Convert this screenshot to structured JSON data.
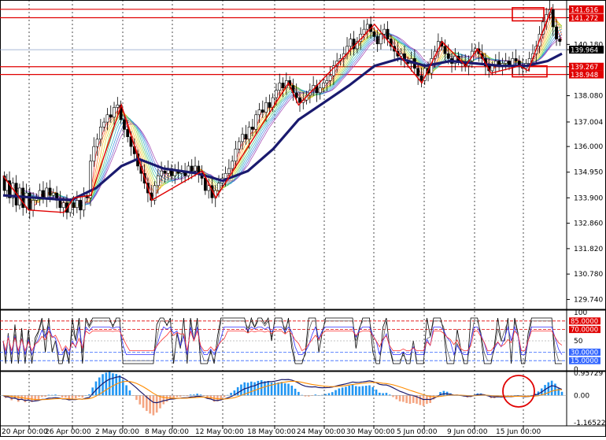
{
  "colors": {
    "background": "#ffffff",
    "grid": "#000000",
    "candle": "#000000",
    "zigzag": "#e00000",
    "ma_slow": "#1a1a6e",
    "level": "#e00000",
    "current_price_line": "#8aa0c8",
    "rsi_black": "#000000",
    "rsi_blue": "#3333ff",
    "rsi_red": "#ff3333",
    "macd_pos": "#2196f3",
    "macd_neg": "#f4a582",
    "macd_line": "#1a1a6e",
    "signal_line": "#ff8c00"
  },
  "chart_data": [
    {
      "type": "candlestick",
      "panel": "price",
      "x_labels": [
        "20 Apr 00:00",
        "26 Apr 00:00",
        "2 May 00:00",
        "8 May 00:00",
        "12 May 00:00",
        "18 May 00:00",
        "24 May 00:00",
        "30 May 00:00",
        "5 Jun 00:00",
        "9 Jun 00:00",
        "15 Jun 00:00"
      ],
      "y_ticks": [
        "141.616",
        "141.272",
        "140.180",
        "139.964",
        "139.267",
        "138.948",
        "138.080",
        "137.004",
        "136.000",
        "134.950",
        "133.900",
        "132.860",
        "131.820",
        "130.780",
        "129.740"
      ],
      "ylim": [
        129.4,
        141.9
      ],
      "current_price": 139.964,
      "levels": [
        141.616,
        141.272,
        139.267,
        138.948
      ],
      "ohlc_path": [
        [
          0,
          134.8
        ],
        [
          3,
          134.2
        ],
        [
          6,
          134.6
        ],
        [
          10,
          133.9
        ],
        [
          14,
          134.5
        ],
        [
          18,
          133.6
        ],
        [
          22,
          134.3
        ],
        [
          26,
          133.5
        ],
        [
          30,
          134.1
        ],
        [
          34,
          133.4
        ],
        [
          38,
          133.8
        ],
        [
          42,
          133.9
        ],
        [
          46,
          134.2
        ],
        [
          50,
          133.9
        ],
        [
          54,
          134.3
        ],
        [
          58,
          134.0
        ],
        [
          62,
          134.1
        ],
        [
          66,
          133.8
        ],
        [
          70,
          133.5
        ],
        [
          74,
          133.7
        ],
        [
          78,
          133.3
        ],
        [
          82,
          133.7
        ],
        [
          86,
          133.5
        ],
        [
          90,
          133.8
        ],
        [
          94,
          133.4
        ],
        [
          98,
          134.0
        ],
        [
          102,
          133.9
        ],
        [
          106,
          135.4
        ],
        [
          110,
          136.0
        ],
        [
          114,
          136.3
        ],
        [
          118,
          136.8
        ],
        [
          122,
          137.0
        ],
        [
          126,
          137.3
        ],
        [
          130,
          137.2
        ],
        [
          134,
          137.6
        ],
        [
          138,
          137.7
        ],
        [
          142,
          137.1
        ],
        [
          146,
          136.7
        ],
        [
          150,
          136.4
        ],
        [
          154,
          136.0
        ],
        [
          158,
          135.7
        ],
        [
          162,
          135.2
        ],
        [
          166,
          134.9
        ],
        [
          170,
          134.5
        ],
        [
          174,
          134.1
        ],
        [
          178,
          133.8
        ],
        [
          182,
          134.4
        ],
        [
          186,
          134.8
        ],
        [
          190,
          135.0
        ],
        [
          194,
          134.9
        ],
        [
          198,
          135.1
        ],
        [
          202,
          134.8
        ],
        [
          206,
          135.0
        ],
        [
          210,
          134.9
        ],
        [
          214,
          135.0
        ],
        [
          218,
          134.8
        ],
        [
          222,
          135.2
        ],
        [
          226,
          135.0
        ],
        [
          230,
          135.2
        ],
        [
          234,
          134.9
        ],
        [
          238,
          134.7
        ],
        [
          242,
          134.2
        ],
        [
          246,
          134.4
        ],
        [
          250,
          133.9
        ],
        [
          254,
          134.2
        ],
        [
          258,
          134.5
        ],
        [
          262,
          134.7
        ],
        [
          266,
          134.9
        ],
        [
          270,
          135.1
        ],
        [
          274,
          135.4
        ],
        [
          278,
          135.9
        ],
        [
          282,
          136.2
        ],
        [
          286,
          136.5
        ],
        [
          290,
          136.3
        ],
        [
          294,
          136.8
        ],
        [
          298,
          136.7
        ],
        [
          302,
          137.3
        ],
        [
          306,
          137.5
        ],
        [
          310,
          137.4
        ],
        [
          314,
          137.8
        ],
        [
          318,
          137.6
        ],
        [
          322,
          138.0
        ],
        [
          326,
          138.3
        ],
        [
          330,
          138.6
        ],
        [
          334,
          138.4
        ],
        [
          338,
          138.7
        ],
        [
          342,
          138.5
        ],
        [
          346,
          138.2
        ],
        [
          350,
          138.0
        ],
        [
          354,
          137.8
        ],
        [
          358,
          137.9
        ],
        [
          362,
          138.1
        ],
        [
          366,
          138.3
        ],
        [
          370,
          138.5
        ],
        [
          374,
          138.2
        ],
        [
          378,
          138.4
        ],
        [
          382,
          138.6
        ],
        [
          386,
          138.7
        ],
        [
          390,
          138.9
        ],
        [
          394,
          139.3
        ],
        [
          398,
          139.5
        ],
        [
          402,
          139.6
        ],
        [
          406,
          139.8
        ],
        [
          410,
          140.1
        ],
        [
          414,
          140.4
        ],
        [
          418,
          140.0
        ],
        [
          422,
          140.3
        ],
        [
          426,
          140.6
        ],
        [
          430,
          140.8
        ],
        [
          434,
          141.0
        ],
        [
          438,
          140.7
        ],
        [
          442,
          140.5
        ],
        [
          446,
          140.2
        ],
        [
          450,
          140.6
        ],
        [
          454,
          140.8
        ],
        [
          458,
          140.4
        ],
        [
          462,
          140.1
        ],
        [
          466,
          139.9
        ],
        [
          470,
          139.7
        ],
        [
          474,
          139.8
        ],
        [
          478,
          139.5
        ],
        [
          482,
          139.4
        ],
        [
          486,
          139.6
        ],
        [
          490,
          139.2
        ],
        [
          494,
          138.9
        ],
        [
          498,
          138.7
        ],
        [
          502,
          139.2
        ],
        [
          506,
          139.0
        ],
        [
          510,
          139.6
        ],
        [
          514,
          139.9
        ],
        [
          518,
          140.3
        ],
        [
          522,
          140.1
        ],
        [
          526,
          139.8
        ],
        [
          530,
          139.6
        ],
        [
          534,
          139.4
        ],
        [
          538,
          139.7
        ],
        [
          542,
          139.5
        ],
        [
          546,
          139.4
        ],
        [
          550,
          139.3
        ],
        [
          554,
          139.5
        ],
        [
          558,
          139.9
        ],
        [
          562,
          140.0
        ],
        [
          566,
          139.8
        ],
        [
          570,
          139.6
        ],
        [
          574,
          139.3
        ],
        [
          578,
          139.1
        ],
        [
          582,
          139.3
        ],
        [
          586,
          139.5
        ],
        [
          590,
          139.3
        ],
        [
          594,
          139.4
        ],
        [
          598,
          139.5
        ],
        [
          602,
          139.3
        ],
        [
          606,
          139.6
        ],
        [
          610,
          139.5
        ],
        [
          614,
          139.3
        ],
        [
          618,
          139.2
        ],
        [
          622,
          139.4
        ],
        [
          626,
          139.6
        ],
        [
          630,
          139.8
        ],
        [
          634,
          140.1
        ],
        [
          638,
          140.6
        ],
        [
          642,
          141.1
        ],
        [
          646,
          141.4
        ],
        [
          650,
          141.6
        ],
        [
          654,
          140.9
        ],
        [
          658,
          140.4
        ],
        [
          662,
          140.3
        ]
      ],
      "zigzag": [
        [
          0,
          134.8
        ],
        [
          30,
          133.4
        ],
        [
          72,
          133.3
        ],
        [
          84,
          133.9
        ],
        [
          104,
          134.0
        ],
        [
          140,
          137.7
        ],
        [
          176,
          133.8
        ],
        [
          236,
          135.0
        ],
        [
          252,
          133.9
        ],
        [
          338,
          138.6
        ],
        [
          350,
          137.7
        ],
        [
          440,
          141.0
        ],
        [
          496,
          138.6
        ],
        [
          520,
          140.3
        ],
        [
          548,
          139.3
        ],
        [
          562,
          140.0
        ],
        [
          578,
          139.0
        ],
        [
          612,
          139.3
        ],
        [
          622,
          139.1
        ],
        [
          650,
          141.7
        ]
      ],
      "ma_slow": [
        [
          0,
          134.0
        ],
        [
          40,
          133.9
        ],
        [
          80,
          133.8
        ],
        [
          110,
          134.3
        ],
        [
          140,
          135.2
        ],
        [
          160,
          135.5
        ],
        [
          190,
          135.1
        ],
        [
          230,
          134.9
        ],
        [
          260,
          134.6
        ],
        [
          290,
          135.0
        ],
        [
          320,
          135.9
        ],
        [
          350,
          137.1
        ],
        [
          380,
          137.8
        ],
        [
          410,
          138.5
        ],
        [
          440,
          139.3
        ],
        [
          470,
          139.6
        ],
        [
          500,
          139.3
        ],
        [
          530,
          139.5
        ],
        [
          560,
          139.4
        ],
        [
          590,
          139.3
        ],
        [
          620,
          139.3
        ],
        [
          645,
          139.5
        ],
        [
          662,
          139.8
        ]
      ]
    },
    {
      "type": "line",
      "panel": "rsi",
      "y_ticks": [
        "100",
        "85.0000",
        "70.0000",
        "50",
        "30.0000",
        "15.0000",
        "0"
      ],
      "ylim": [
        0,
        100
      ],
      "levels": [
        85,
        70,
        50,
        30,
        15
      ]
    },
    {
      "type": "bar",
      "panel": "macd",
      "y_ticks": [
        "0.95729",
        "0.00",
        "-1.16522"
      ],
      "ylim": [
        -1.16522,
        0.95729
      ]
    }
  ]
}
